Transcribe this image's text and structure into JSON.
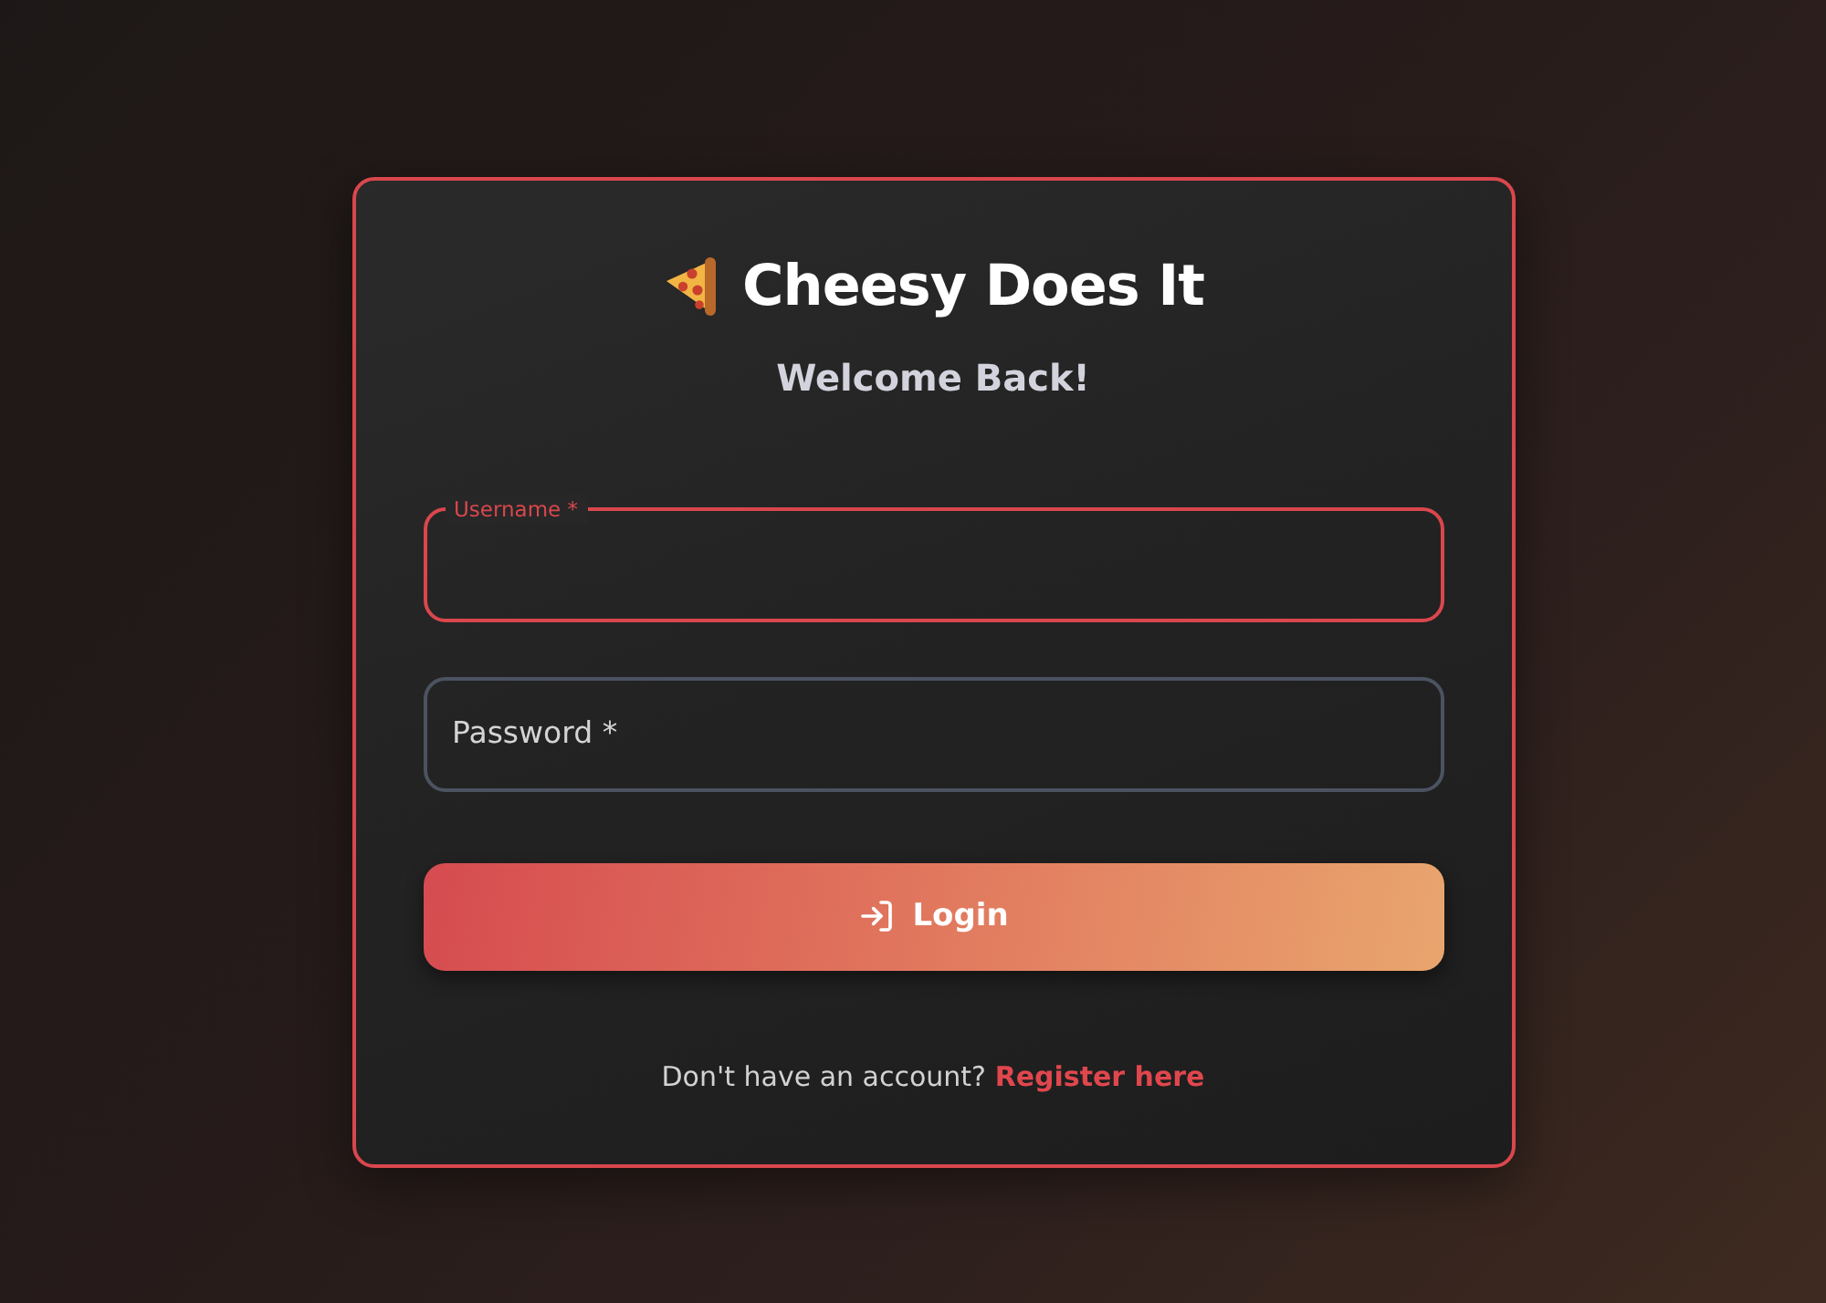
{
  "header": {
    "title": "Cheesy Does It",
    "subtitle": "Welcome Back!"
  },
  "fields": [
    {
      "label": "Username *",
      "focused": true
    },
    {
      "label": "Password *",
      "focused": false
    }
  ],
  "submit": {
    "label": "Login"
  },
  "footer": {
    "prompt": "Don't have an account?",
    "link": "Register here"
  }
}
